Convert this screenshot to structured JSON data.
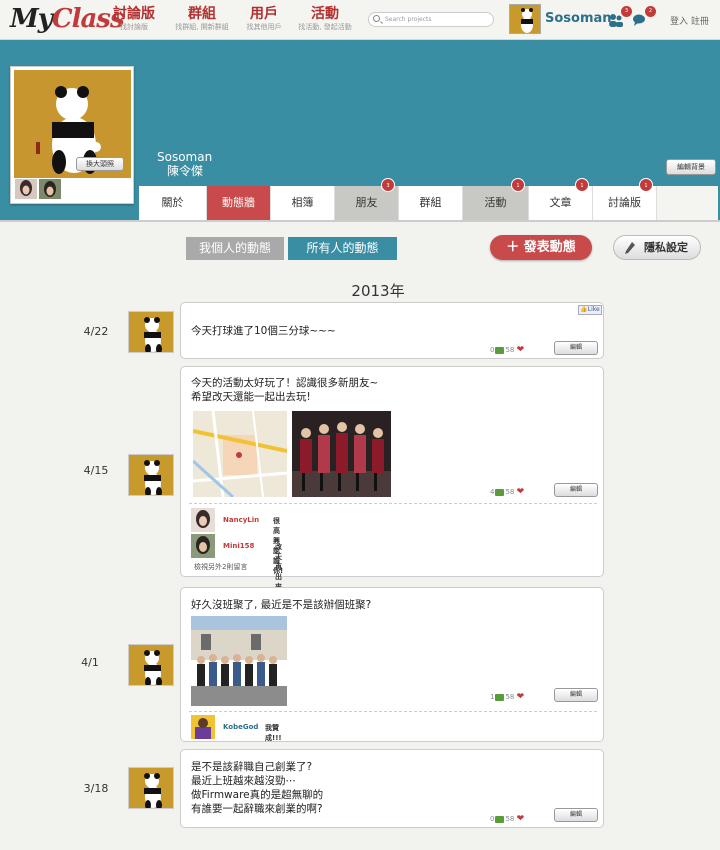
{
  "app": {
    "logo_a": "My",
    "logo_b": "Class"
  },
  "nav": [
    {
      "label": "討論版",
      "sub": "找討論版"
    },
    {
      "label": "群組",
      "sub": "找群組, 開新群組"
    },
    {
      "label": "用戶",
      "sub": "找其他用戶"
    },
    {
      "label": "活動",
      "sub": "找活動, 發起活動"
    }
  ],
  "search": {
    "placeholder": "Search projects"
  },
  "user": {
    "name": "Sosoman",
    "friend_count": "3",
    "chat_count": "2",
    "auth": "登入 註冊"
  },
  "profile": {
    "name_en": "Sosoman",
    "name_cn": "陳令傑",
    "enlarge_label": "換大頭照",
    "edit_bg_label": "編輯背景"
  },
  "tabs": [
    {
      "label": "關於",
      "badge": ""
    },
    {
      "label": "動態牆",
      "badge": ""
    },
    {
      "label": "相簿",
      "badge": ""
    },
    {
      "label": "朋友",
      "badge": "3"
    },
    {
      "label": "群組",
      "badge": ""
    },
    {
      "label": "活動",
      "badge": "1"
    },
    {
      "label": "文章",
      "badge": "1"
    },
    {
      "label": "討論版",
      "badge": "1"
    }
  ],
  "filters": {
    "mine": "我個人的動態",
    "all": "所有人的動態"
  },
  "actions": {
    "post": "發表動態",
    "privacy": "隱私設定"
  },
  "year": "2013年",
  "like_label": "Like",
  "edit_label": "編輯",
  "posts": [
    {
      "date": "4/22",
      "lines": [
        "今天打球進了10個三分球~~~"
      ],
      "comments": "0",
      "likes": "58"
    },
    {
      "date": "4/15",
      "lines": [
        "今天的活動太好玩了！認識很多新朋友~",
        "希望改天還能一起出去玩!"
      ],
      "comments": "4",
      "likes": "58",
      "replies": [
        {
          "name": "NancyLin",
          "text": "很高興認識你!"
        },
        {
          "name": "Mini158",
          "text": "改天再出來玩 lol"
        }
      ],
      "more": "檢視另外2則留言"
    },
    {
      "date": "4/1",
      "lines": [
        "好久沒班聚了, 最近是不是該辦個班聚?"
      ],
      "comments": "1",
      "likes": "58",
      "replies": [
        {
          "name": "KobeGod",
          "text": "我贊成!!!"
        }
      ]
    },
    {
      "date": "3/18",
      "lines": [
        "是不是該辭職自己創業了?",
        "最近上班越來越沒勁⋯",
        "做Firmware真的是超無聊的",
        "有誰要一起辭職來創業的啊?"
      ],
      "comments": "0",
      "likes": "58"
    }
  ]
}
